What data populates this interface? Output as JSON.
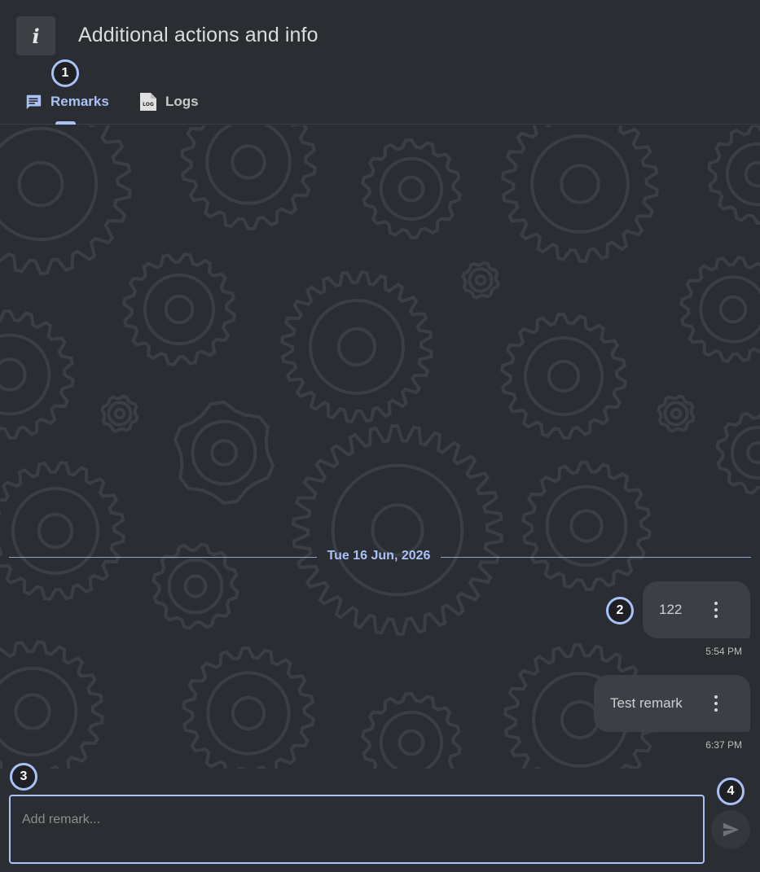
{
  "header": {
    "info_icon_glyph": "i",
    "title": "Additional actions and info"
  },
  "tabs": [
    {
      "label": "Remarks",
      "icon": "message-icon",
      "active": true
    },
    {
      "label": "Logs",
      "icon": "log-file-icon",
      "active": false
    }
  ],
  "chat": {
    "date_separator": "Tue 16 Jun, 2026",
    "messages": [
      {
        "text": "122",
        "time": "5:54 PM"
      },
      {
        "text": "Test remark",
        "time": "6:37 PM"
      }
    ]
  },
  "composer": {
    "placeholder": "Add remark...",
    "send_icon": "send-icon"
  },
  "callouts": [
    "1",
    "2",
    "3",
    "4"
  ],
  "colors": {
    "accent": "#a8c1f7",
    "background": "#2a2d31",
    "bubble": "#3c4046",
    "gear_pattern": "#3b3f45"
  }
}
